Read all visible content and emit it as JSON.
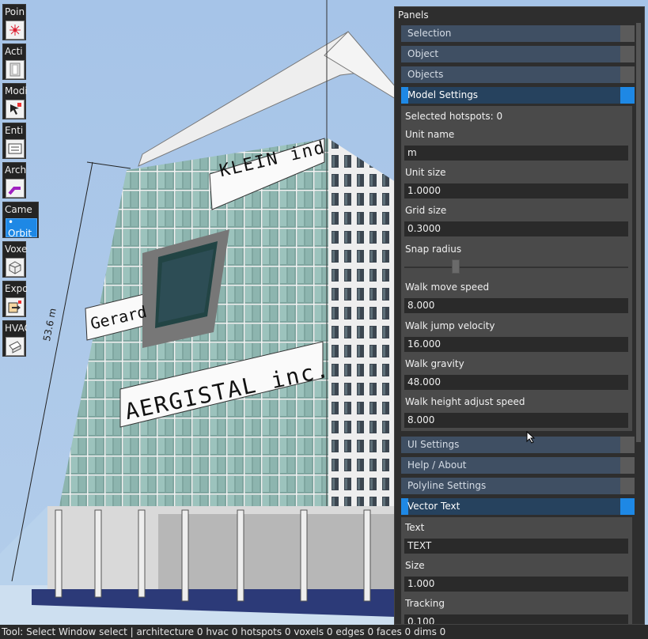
{
  "toolbar": {
    "groups": [
      {
        "title": "Poin",
        "icon": "point-star-icon"
      },
      {
        "title": "Acti",
        "icon": "action-window-icon"
      },
      {
        "title": "Modi",
        "icon": "modify-arrow-icon"
      },
      {
        "title": "Enti",
        "icon": "entity-ruler-icon"
      },
      {
        "title": "Arch",
        "icon": "arch-wall-icon"
      },
      {
        "title": "Came",
        "icon": "camera-orbit",
        "active_label": "• Orbit"
      },
      {
        "title": "Voxe",
        "icon": "voxel-cube-icon"
      },
      {
        "title": "Expo",
        "icon": "export-icon"
      },
      {
        "title": "HVAC",
        "icon": "hvac-duct-icon"
      }
    ]
  },
  "scene": {
    "dimension_label": "53.6 m",
    "signs": [
      "KLEIN ind",
      "Gerard",
      "AERGISTAL inc."
    ]
  },
  "panels": {
    "title": "Panels",
    "headers": {
      "selection": "Selection",
      "object": "Object",
      "objects": "Objects",
      "model_settings": "Model Settings",
      "ui_settings": "UI Settings",
      "help_about": "Help / About",
      "polyline_settings": "Polyline Settings",
      "vector_text": "Vector Text"
    },
    "model_settings": {
      "selected_hotspots": "Selected hotspots: 0",
      "unit_name_label": "Unit name",
      "unit_name": "m",
      "unit_size_label": "Unit size",
      "unit_size": "1.0000",
      "grid_size_label": "Grid size",
      "grid_size": "0.3000",
      "snap_radius_label": "Snap radius",
      "snap_radius_fraction": 0.22,
      "walk_move_speed_label": "Walk move speed",
      "walk_move_speed": "8.000",
      "walk_jump_velocity_label": "Walk jump velocity",
      "walk_jump_velocity": "16.000",
      "walk_gravity_label": "Walk gravity",
      "walk_gravity": "48.000",
      "walk_height_adjust_speed_label": "Walk height adjust speed",
      "walk_height_adjust_speed": "8.000"
    },
    "vector_text": {
      "text_label": "Text",
      "text": "TEXT",
      "size_label": "Size",
      "size": "1.000",
      "tracking_label": "Tracking",
      "tracking": "0.100"
    }
  },
  "status_bar": "Tool: Select Window select | architecture 0 hvac 0 hotspots 0 voxels 0 edges 0 faces 0 dims 0",
  "colors": {
    "accent": "#1e88e5",
    "panel_bg": "#2e2e2e",
    "section_bg": "#4a4a4a"
  }
}
